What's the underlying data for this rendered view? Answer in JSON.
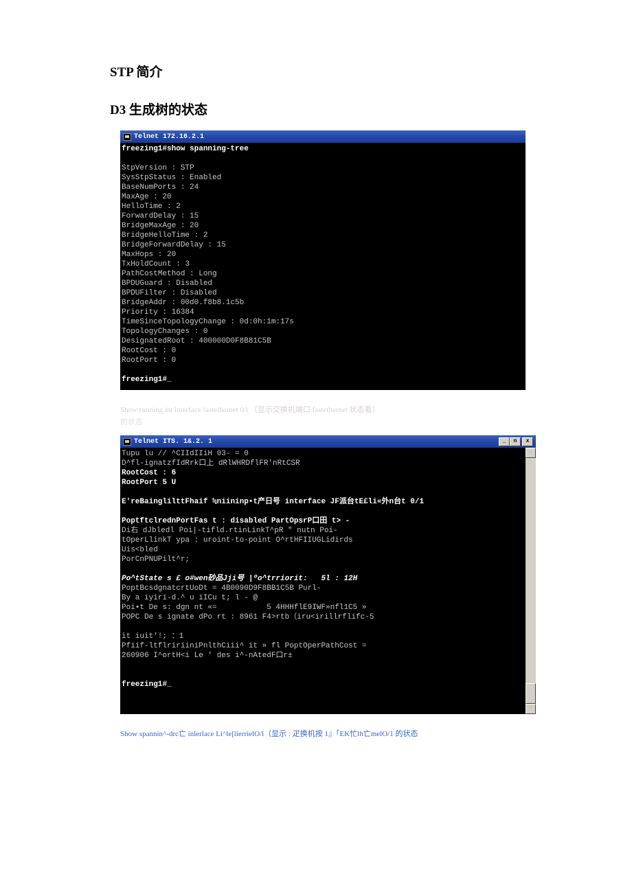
{
  "titles": {
    "section1": "STP 简介",
    "section2": "D3 生成树的状态"
  },
  "terminal1": {
    "title": "Telnet 172.16.2.1",
    "prompt1": "freezing1#show spanning-tree",
    "lines": [
      "StpVersion : STP",
      "SysStpStatus : Enabled",
      "BaseNumPorts : 24",
      "MaxAge : 20",
      "HelloTime : 2",
      "ForwardDelay : 15",
      "BridgeMaxAge : 20",
      "BridgeHelloTime : 2",
      "BridgeForwardDelay : 15",
      "MaxHops : 20",
      "TxHoldCount : 3",
      "PathCostMethod : Long",
      "BPDUGuard : Disabled",
      "BPDUFilter : Disabled",
      "BridgeAddr : 00d0.f8b8.1c5b",
      "Priority : 16384",
      "TimeSinceTopologyChange : 0d:0h:1m:17s",
      "TopologyChanges : 0",
      "DesignatedRoot : 400000D0F8B81C5B",
      "RootCost : 0",
      "RootPort : 0"
    ],
    "prompt2": "freezing1#_"
  },
  "captions": {
    "faded1": "Show running int interface fastethernet 0/l （显示交换机端口 fastethernet 状态看）",
    "faded2": "的状态",
    "bottom": "Show spannin^-drc亡  inlerlace Li^le[lierrielO/l（显示 : 疋换机按  1』「EK忙lh亡melO/1 的状态"
  },
  "terminal2": {
    "title": "Telnet ITS. 1&.2.    1",
    "blocks": [
      "Tupu lu // ^CIIdIIiH 03- = 0",
      "D^fl-ignatzfIdRrk口上 dRlWHRDflFR'nRtCSR",
      "RootCost : 6",
      "RootPort 5 U",
      "",
      "E'reBainglilttFhaif ≒niininp•t产日号 interface JF派台tE£li«外n台t 0/1",
      "",
      "PoptftclrednPortFas t : disabled PartOpsrP口田 t> -",
      "Di右 dJbledl Poi|-tifld.rtinLinkT^pR \" nutn Poi-",
      "tOperLlinkT ypa : uroint-to-point O^rtHFIIUGLidirds",
      "Uis<bled",
      "PorCnPNUPilt^r;",
      "",
      "Po^tState s £ o#wen砂品Jji号 |ºo^trriorit:   5l : 12H",
      "PoptBcsdgnatcrtUoDt = 4B0090D9F8BB1C5B Purl-",
      "By a iyiri-d.^ u iICu t; l - @",
      "Poi•t De s: dgn nt «=           5 4HHHflE9IWF»nfl1C5 »",
      "POPC De s ignate dPo rt : 8961 F4>rtb（iru<irillrflifc-5",
      "",
      "it iuit'!; ：1",
      "Pfiif-ltflririiniPnlthCiii^ it » fl PoptOperPathCost =",
      "260906 I^ortH<i Le ' des i^-nAtedF口r±"
    ],
    "prompt": "freezing1#_"
  }
}
